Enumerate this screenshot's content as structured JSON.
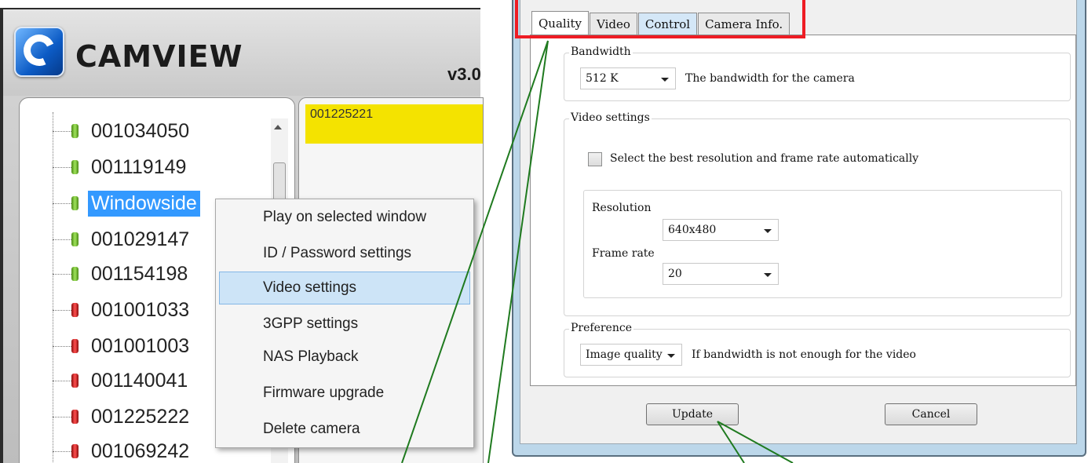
{
  "app": {
    "brand": "CAMVIEW",
    "version": "v3.0",
    "logo_icon": "camview-logo-icon"
  },
  "camera_tree": {
    "items": [
      {
        "label": "001034050",
        "status": "online"
      },
      {
        "label": "001119149",
        "status": "online"
      },
      {
        "label": "Windowside",
        "status": "online",
        "selected": true
      },
      {
        "label": "001029147",
        "status": "online"
      },
      {
        "label": "001154198",
        "status": "online"
      },
      {
        "label": "001001033",
        "status": "offline"
      },
      {
        "label": "001001003",
        "status": "offline"
      },
      {
        "label": "001140041",
        "status": "offline"
      },
      {
        "label": "001225222",
        "status": "offline"
      },
      {
        "label": "001069242",
        "status": "offline"
      }
    ]
  },
  "video_panel": {
    "title": "001225221"
  },
  "context_menu": {
    "items": [
      {
        "label": "Play on selected window"
      },
      {
        "label": "ID / Password settings"
      },
      {
        "label": "Video settings",
        "highlighted": true
      },
      {
        "label": "3GPP settings"
      },
      {
        "label": "NAS Playback"
      },
      {
        "label": "Firmware upgrade"
      },
      {
        "label": "Delete camera"
      }
    ]
  },
  "dialog": {
    "tabs": [
      {
        "label": "Quality",
        "active": true
      },
      {
        "label": "Video"
      },
      {
        "label": "Control"
      },
      {
        "label": "Camera Info."
      }
    ],
    "bandwidth": {
      "title": "Bandwidth",
      "value": "512 K",
      "description": "The bandwidth for the camera"
    },
    "video_settings": {
      "title": "Video settings",
      "auto_checkbox_label": "Select the best resolution and frame rate automatically",
      "auto_checked": false,
      "resolution_label": "Resolution",
      "resolution_value": "640x480",
      "frame_rate_label": "Frame rate",
      "frame_rate_value": "20"
    },
    "preference": {
      "title": "Preference",
      "value": "Image quality",
      "description": "If bandwidth is not enough for the video"
    },
    "buttons": {
      "update": "Update",
      "cancel": "Cancel"
    }
  },
  "colors": {
    "selection_blue": "#3399ff",
    "highlight_yellow": "#f4e300",
    "annotation_red": "#ee1c24",
    "callout_green": "#1f7a1f",
    "camera_online": "#7fd13b",
    "camera_offline": "#e23a3a"
  }
}
